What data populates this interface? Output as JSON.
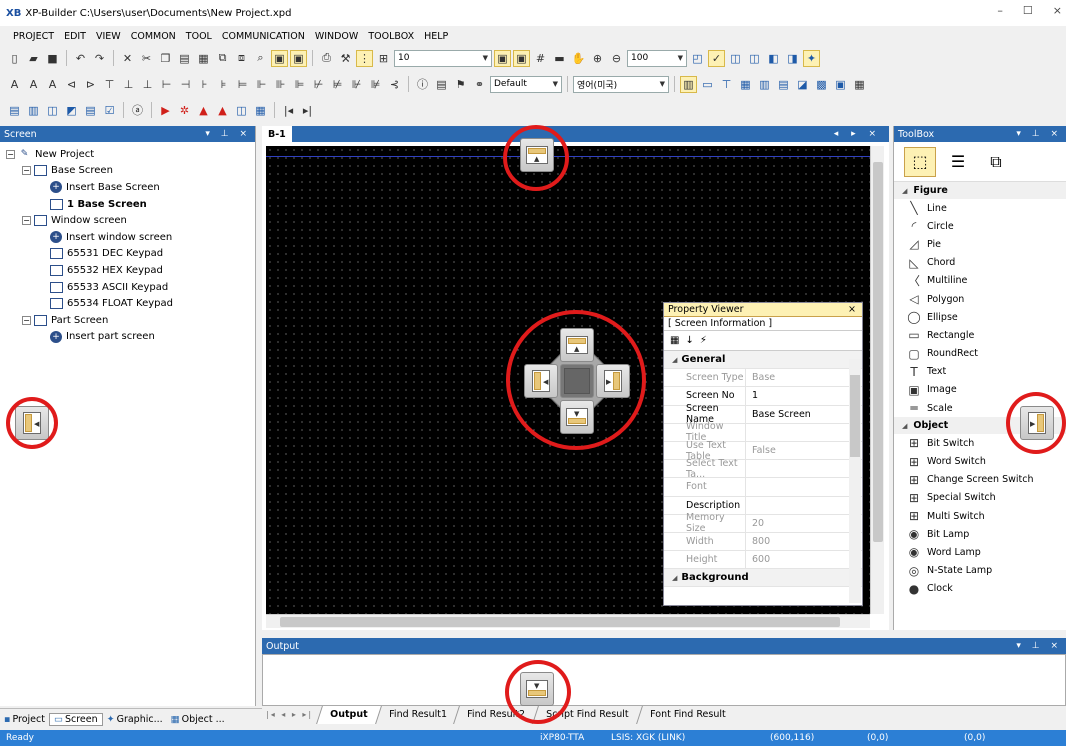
{
  "window": {
    "logo": "XB",
    "title": "XP-Builder C:\\Users\\user\\Documents\\New Project.xpd",
    "min": "–",
    "max": "☐",
    "close": "×"
  },
  "menu": [
    "PROJECT",
    "EDIT",
    "VIEW",
    "COMMON",
    "TOOL",
    "COMMUNICATION",
    "WINDOW",
    "TOOLBOX",
    "HELP"
  ],
  "toolbar": {
    "grid_value": "10",
    "zoom_value": "100",
    "font_style": "Default",
    "language": "영어(미국)"
  },
  "screen_panel": {
    "title": "Screen",
    "controls": "▾ ⊥ ×",
    "tree": [
      {
        "label": "New Project",
        "level": 0,
        "expander": "−",
        "icon": "project-icon"
      },
      {
        "label": "Base Screen",
        "level": 1,
        "expander": "−",
        "icon": "screen-folder-icon"
      },
      {
        "label": "Insert Base Screen",
        "level": 2,
        "icon": "insert-icon"
      },
      {
        "label": "1 Base Screen",
        "level": 2,
        "icon": "screen-icon",
        "bold": true
      },
      {
        "label": "Window screen",
        "level": 1,
        "expander": "−",
        "icon": "window-folder-icon"
      },
      {
        "label": "Insert window screen",
        "level": 2,
        "icon": "insert-icon"
      },
      {
        "label": "65531 DEC Keypad",
        "level": 2,
        "icon": "window-icon"
      },
      {
        "label": "65532 HEX Keypad",
        "level": 2,
        "icon": "window-icon"
      },
      {
        "label": "65533 ASCII Keypad",
        "level": 2,
        "icon": "window-icon"
      },
      {
        "label": "65534 FLOAT Keypad",
        "level": 2,
        "icon": "window-icon"
      },
      {
        "label": "Part Screen",
        "level": 1,
        "expander": "−",
        "icon": "part-folder-icon"
      },
      {
        "label": "Insert part screen",
        "level": 2,
        "icon": "insert-icon"
      }
    ],
    "bottom_tabs": [
      "Project",
      "Screen",
      "Graphic...",
      "Object ..."
    ]
  },
  "editor": {
    "tab": "B-1",
    "controls": "◂ ▸ ×"
  },
  "property_viewer": {
    "title": "Property Viewer",
    "close": "×",
    "subtitle": "[ Screen Information ]",
    "categories": [
      {
        "name": "General",
        "rows": [
          {
            "k": "Screen Type",
            "v": "Base",
            "dim": true
          },
          {
            "k": "Screen No",
            "v": "1",
            "dim": false
          },
          {
            "k": "Screen Name",
            "v": "Base Screen",
            "dim": false
          },
          {
            "k": "Window Title",
            "v": "",
            "dim": true
          },
          {
            "k": "Use Text Table",
            "v": "False",
            "dim": true
          },
          {
            "k": "Select Text Ta...",
            "v": "",
            "dim": true
          },
          {
            "k": "Font",
            "v": "",
            "dim": true
          },
          {
            "k": "Description",
            "v": "",
            "dim": false
          },
          {
            "k": "Memory Size",
            "v": "20",
            "dim": true
          },
          {
            "k": "Width",
            "v": "800",
            "dim": true
          },
          {
            "k": "Height",
            "v": "600",
            "dim": true
          }
        ]
      },
      {
        "name": "Background",
        "rows": []
      }
    ]
  },
  "toolbox": {
    "title": "ToolBox",
    "controls": "▾ ⊥ ×",
    "categories": [
      {
        "name": "Figure",
        "items": [
          {
            "label": "Line",
            "glyph": "╲"
          },
          {
            "label": "Circle",
            "glyph": "◜"
          },
          {
            "label": "Pie",
            "glyph": "◿"
          },
          {
            "label": "Chord",
            "glyph": "◺"
          },
          {
            "label": "Multiline",
            "glyph": "〈"
          },
          {
            "label": "Polygon",
            "glyph": "◁"
          },
          {
            "label": "Ellipse",
            "glyph": "◯"
          },
          {
            "label": "Rectangle",
            "glyph": "▭"
          },
          {
            "label": "RoundRect",
            "glyph": "▢"
          },
          {
            "label": "Text",
            "glyph": "T"
          },
          {
            "label": "Image",
            "glyph": "▣"
          },
          {
            "label": "Scale",
            "glyph": "═"
          }
        ]
      },
      {
        "name": "Object",
        "items": [
          {
            "label": "Bit Switch",
            "glyph": "⊞"
          },
          {
            "label": "Word Switch",
            "glyph": "⊞"
          },
          {
            "label": "Change Screen Switch",
            "glyph": "⊞"
          },
          {
            "label": "Special Switch",
            "glyph": "⊞"
          },
          {
            "label": "Multi Switch",
            "glyph": "⊞"
          },
          {
            "label": "Bit Lamp",
            "glyph": "◉"
          },
          {
            "label": "Word Lamp",
            "glyph": "◉"
          },
          {
            "label": "N-State Lamp",
            "glyph": "◎"
          },
          {
            "label": "Clock",
            "glyph": "●"
          }
        ]
      }
    ]
  },
  "output": {
    "title": "Output",
    "controls": "▾ ⊥ ×",
    "nav": "|◂ ◂ ▸ ▸|",
    "tabs": [
      "Output",
      "Find Result1",
      "Find Result2",
      "Script Find Result",
      "Font Find Result"
    ],
    "active_tab": "Output"
  },
  "status": {
    "ready": "Ready",
    "device": "iXP80-TTA",
    "link": "LSIS: XGK (LINK)",
    "pos": "(600,116)",
    "a": "(0,0)",
    "b": "(0,0)"
  },
  "colors": {
    "accent": "#2c6ab0",
    "status": "#2c7fd5",
    "highlight_circle": "#e01b1b"
  }
}
